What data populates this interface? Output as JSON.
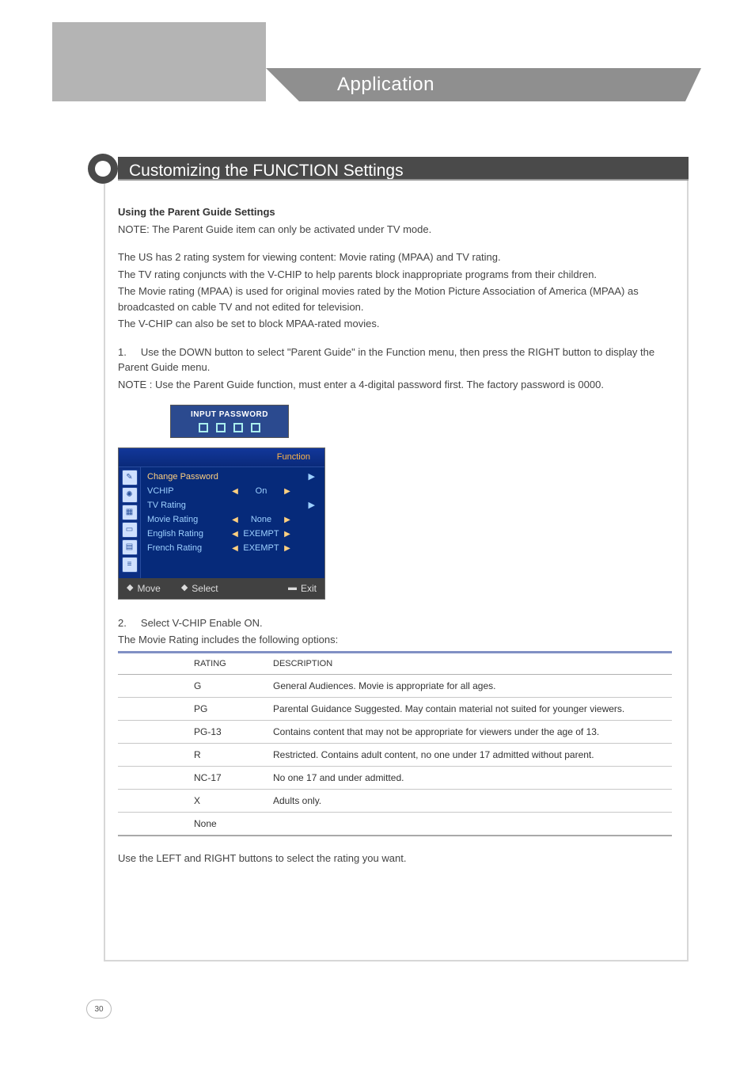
{
  "header": {
    "tab_title": "Application"
  },
  "section": {
    "title": "Customizing the FUNCTION Settings"
  },
  "body": {
    "subtitle": "Using the Parent Guide Settings",
    "note1": "NOTE: The Parent Guide item can only be activated under TV mode.",
    "p1": "The US has 2 rating system for viewing content: Movie rating (MPAA) and TV rating.",
    "p2": "The TV rating conjuncts with the V-CHIP to help parents block inappropriate programs from their children.",
    "p3": "The Movie rating (MPAA) is used for original movies rated by the Motion Picture Association of America (MPAA) as broadcasted on cable TV and not edited for television.",
    "p4": "The V-CHIP can also be set to block MPAA-rated movies.",
    "step1_num": "1.",
    "step1": "Use the DOWN button to select \"Parent Guide\" in the Function menu, then press the RIGHT button to display the Parent Guide menu.",
    "note2": "NOTE : Use the Parent Guide function, must enter a 4-digital password first. The factory password is 0000.",
    "step2_num": "2.",
    "step2": "Select V-CHIP Enable ON.",
    "step2_sub": "The Movie Rating includes the following options:",
    "footer_line": "Use the LEFT and RIGHT buttons to select the rating you want."
  },
  "password_box": {
    "title": "INPUT PASSWORD"
  },
  "osd": {
    "title": "Function",
    "items": [
      {
        "label": "Change Password",
        "value": "",
        "solo_arrow": true
      },
      {
        "label": "VCHIP",
        "value": "On"
      },
      {
        "label": "TV Rating",
        "value": "",
        "solo_arrow": true
      },
      {
        "label": "Movie Rating",
        "value": "None"
      },
      {
        "label": "English Rating",
        "value": "EXEMPT"
      },
      {
        "label": "French Rating",
        "value": "EXEMPT"
      }
    ],
    "footer": {
      "move": "Move",
      "select": "Select",
      "exit": "Exit"
    }
  },
  "table": {
    "head": {
      "rating": "RATING",
      "desc": "DESCRIPTION"
    },
    "rows": [
      {
        "r": "G",
        "d": "General Audiences. Movie is appropriate for all ages."
      },
      {
        "r": "PG",
        "d": "Parental Guidance Suggested. May contain material not suited for younger viewers."
      },
      {
        "r": "PG-13",
        "d": "Contains content that may not be appropriate for viewers under the age of 13."
      },
      {
        "r": "R",
        "d": "Restricted. Contains adult content, no one under 17 admitted without parent."
      },
      {
        "r": "NC-17",
        "d": "No one 17 and under admitted."
      },
      {
        "r": "X",
        "d": "Adults only."
      },
      {
        "r": "None",
        "d": ""
      }
    ]
  },
  "page_number": "30"
}
